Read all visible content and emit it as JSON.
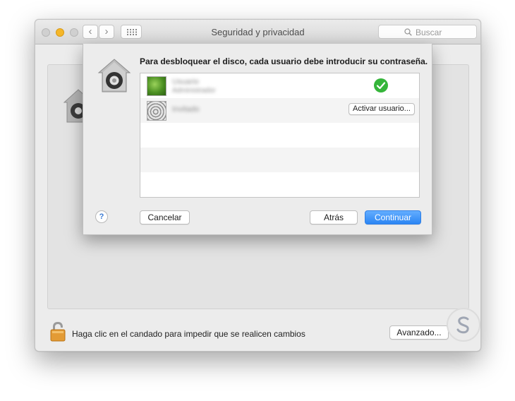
{
  "window": {
    "title": "Seguridad y privacidad",
    "search_placeholder": "Buscar",
    "nav_back_icon": "chevron-left-icon",
    "nav_forward_icon": "chevron-right-icon"
  },
  "sheet": {
    "title": "Para desbloquear el disco, cada usuario debe introducir su contraseña.",
    "users": [
      {
        "name": "Usuario",
        "subtitle": "Administrador",
        "status": "enabled",
        "status_icon": "checkmark-icon"
      },
      {
        "name": "Invitado",
        "action_label": "Activar usuario..."
      }
    ],
    "help_label": "?",
    "cancel_label": "Cancelar",
    "back_label": "Atrás",
    "continue_label": "Continuar"
  },
  "footer": {
    "lock_text": "Haga clic en el candado para impedir que se realicen cambios",
    "advanced_label": "Avanzado..."
  },
  "colors": {
    "accent": "#2b85f3",
    "check": "#35b53a",
    "minimize": "#f5b72a"
  }
}
